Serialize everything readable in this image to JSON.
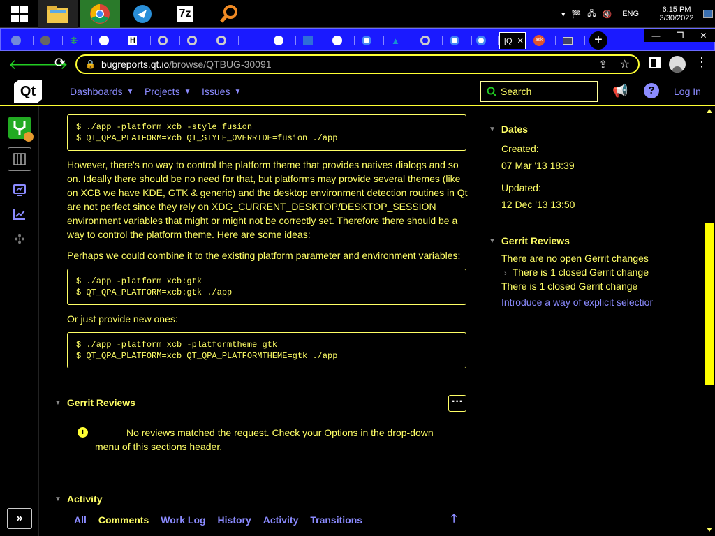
{
  "taskbar": {
    "apps": [
      "start-icon",
      "file-explorer-icon",
      "chrome-icon",
      "app-icon",
      "7zip-icon",
      "search-app-icon"
    ],
    "tray": {
      "lang": "ENG",
      "time": "6:15 PM",
      "date": "3/30/2022",
      "show_hidden": "▾"
    }
  },
  "tabs": {
    "items": [
      "discord",
      "web",
      "slack",
      "github",
      "hn",
      "chrome",
      "chrome",
      "chrome",
      "github",
      "jira",
      "github",
      "google",
      "arch",
      "chrome",
      "google",
      "google",
      "qt",
      "ask",
      "monitor"
    ],
    "active_label": "[Q",
    "close": "✕",
    "new_tab": "+",
    "window": {
      "min": "—",
      "max": "❐",
      "close": "✕"
    }
  },
  "address": {
    "domain": "bugreports.qt.io",
    "path": "/browse/QTBUG-30091"
  },
  "header": {
    "logo": "Qt",
    "nav": [
      "Dashboards",
      "Projects",
      "Issues"
    ],
    "search_label": "Search",
    "login": "Log In"
  },
  "main": {
    "code1": "$ ./app -platform xcb -style fusion\n$ QT_QPA_PLATFORM=xcb QT_STYLE_OVERRIDE=fusion ./app",
    "para1": "However, there's no way to control the platform theme that provides natives dialogs and so on. Ideally there should be no need for that, but platforms may provide several themes (like on XCB we have KDE, GTK & generic) and the desktop environment detection routines in Qt are not perfect since they rely on XDG_CURRENT_DESKTOP/DESKTOP_SESSION environment variables that might or might not be correctly set. Therefore there should be a way to control the platform theme. Here are some ideas:",
    "para2": "Perhaps we could combine it to the existing platform parameter and environment variables:",
    "code2": "$ ./app -platform xcb:gtk\n$ QT_QPA_PLATFORM=xcb:gtk ./app",
    "para3": "Or just provide new ones:",
    "code3": "$ ./app -platform xcb -platformtheme gtk\n$ QT_QPA_PLATFORM=xcb QT_QPA_PLATFORMTHEME=gtk ./app",
    "gerrit_title": "Gerrit Reviews",
    "gerrit_msg": "No reviews matched the request. Check your Options in the drop-down menu of this sections header.",
    "activity_title": "Activity",
    "activity_tabs": [
      "All",
      "Comments",
      "Work Log",
      "History",
      "Activity",
      "Transitions"
    ]
  },
  "right": {
    "dates_title": "Dates",
    "created_label": "Created:",
    "created_value": "07 Mar '13 18:39",
    "updated_label": "Updated:",
    "updated_value": "12 Dec '13 13:50",
    "gerrit_title": "Gerrit Reviews",
    "gerrit_open": "There are no open Gerrit changes",
    "gerrit_closed_toggle": "There is 1 closed Gerrit change",
    "gerrit_closed": "There is 1 closed Gerrit change",
    "gerrit_link": "Introduce a way of explicit selectior"
  },
  "colors": {
    "accent": "#ffff66",
    "link": "#8b8bff",
    "tabbar": "#1a1aff",
    "green": "#22cc22"
  }
}
